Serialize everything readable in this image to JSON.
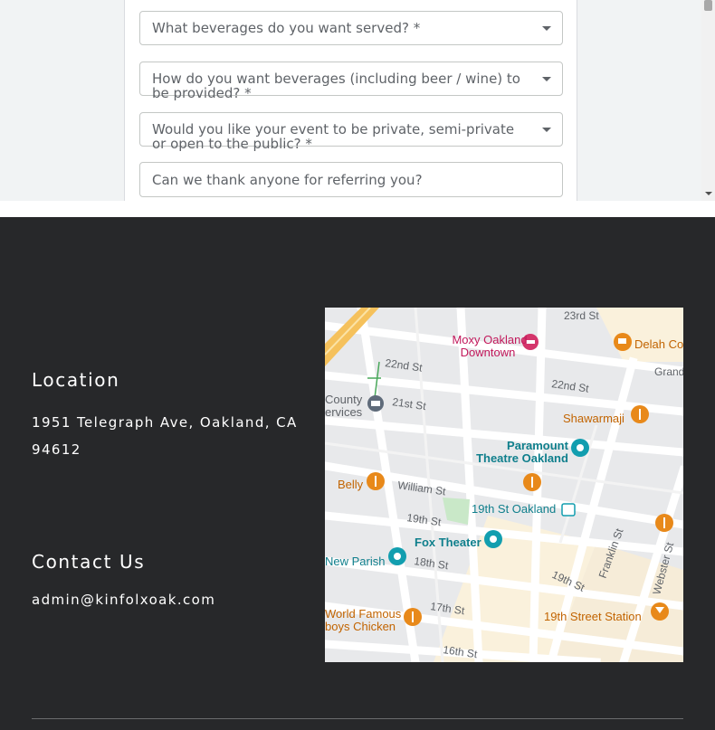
{
  "form": {
    "fields": [
      {
        "label": "What beverages do you want served? *",
        "type": "dropdown"
      },
      {
        "label": "How do you want beverages (including beer / wine) to be provided? *",
        "type": "dropdown"
      },
      {
        "label": "Would you like your event to be private, semi-private or open to the public? *",
        "type": "dropdown"
      },
      {
        "placeholder": "Can we thank anyone for referring you?",
        "type": "text"
      }
    ]
  },
  "footer": {
    "location": {
      "heading": "Location",
      "address": "1951 Telegraph Ave, Oakland, CA 94612"
    },
    "contact": {
      "heading": "Contact Us",
      "email": "admin@kinfolxoak.com"
    }
  },
  "map": {
    "streets": [
      "23rd St",
      "22nd St",
      "22nd St",
      "21st St",
      "William St",
      "19th St",
      "18th St",
      "17th St",
      "16th St",
      "19th St",
      "Franklin St",
      "Webster St",
      "Grand"
    ],
    "places": [
      {
        "name": "Moxy Oakland Downtown",
        "lines": [
          "Moxy Oakland",
          "Downtown"
        ],
        "kind": "hotel",
        "color": "#d4356b"
      },
      {
        "name": "Delah Co",
        "lines": [
          "Delah Co"
        ],
        "kind": "cafe",
        "color": "#e8891a"
      },
      {
        "name": "County Services",
        "lines": [
          "County",
          "ervices"
        ],
        "kind": "government",
        "color": "#5f6b7a"
      },
      {
        "name": "Shawarmaji",
        "lines": [
          "Shawarmaji"
        ],
        "kind": "restaurant",
        "color": "#e8891a"
      },
      {
        "name": "Paramount Theatre Oakland",
        "lines": [
          "Paramount",
          "Theatre Oakland"
        ],
        "kind": "theater",
        "color": "#129eaf"
      },
      {
        "name": "Belly",
        "lines": [
          "Belly"
        ],
        "kind": "restaurant",
        "color": "#e8891a"
      },
      {
        "name": "19th St Oakland",
        "lines": [
          "19th St Oakland"
        ],
        "kind": "transit",
        "color": "#129eaf"
      },
      {
        "name": "Fox Theater",
        "lines": [
          "Fox Theater"
        ],
        "kind": "theater",
        "color": "#129eaf"
      },
      {
        "name": "New Parish",
        "lines": [
          "New Parish"
        ],
        "kind": "theater",
        "color": "#129eaf"
      },
      {
        "name": "World Famous Cowboys Chicken",
        "lines": [
          "World Famous",
          "boys Chicken"
        ],
        "kind": "restaurant",
        "color": "#e8891a"
      },
      {
        "name": "19th Street Station",
        "lines": [
          "19th Street Station"
        ],
        "kind": "bar",
        "color": "#e8891a"
      }
    ]
  }
}
